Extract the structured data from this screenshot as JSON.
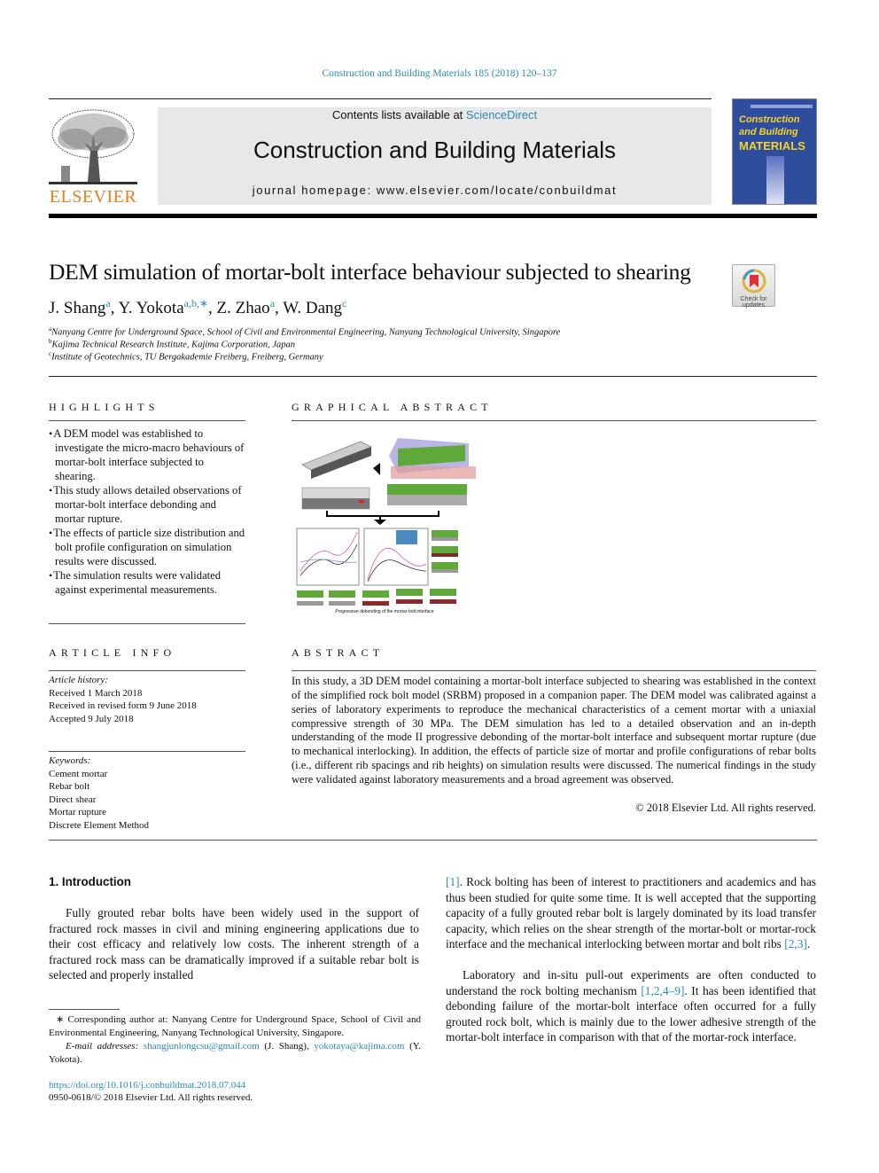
{
  "header": {
    "journal_ref": "Construction and Building Materials 185 (2018) 120–137",
    "contents_prefix": "Contents lists available at ",
    "contents_link": "ScienceDirect",
    "journal_title": "Construction and Building Materials",
    "homepage_prefix": "journal homepage: ",
    "homepage_url": "www.elsevier.com/locate/conbuildmat",
    "publisher_logo": "ELSEVIER",
    "cover": {
      "line1": "Construction",
      "line2": "and Building",
      "line3": "MATERIALS"
    },
    "check_updates": "Check for updates"
  },
  "article": {
    "title": "DEM simulation of mortar-bolt interface behaviour subjected to shearing",
    "authors": [
      {
        "name": "J. Shang",
        "sup": "a"
      },
      {
        "name": "Y. Yokota",
        "sup": "a,b,∗"
      },
      {
        "name": "Z. Zhao",
        "sup": "a"
      },
      {
        "name": "W. Dang",
        "sup": "c"
      }
    ],
    "affiliations": [
      {
        "sup": "a",
        "text": "Nanyang Centre for Underground Space, School of Civil and Environmental Engineering, Nanyang Technological University, Singapore"
      },
      {
        "sup": "b",
        "text": "Kajima Technical Research Institute, Kajima Corporation, Japan"
      },
      {
        "sup": "c",
        "text": "Institute of Geotechnics, TU Bergakademie Freiberg, Freiberg, Germany"
      }
    ]
  },
  "highlights": {
    "heading": "HIGHLIGHTS",
    "items": [
      "A DEM model was established to investigate the micro-macro behaviours of mortar-bolt interface subjected to shearing.",
      "This study allows detailed observations of mortar-bolt interface debonding and mortar rupture.",
      "The effects of particle size distribution and bolt profile configuration on simulation results were discussed.",
      "The simulation results were validated against experimental measurements."
    ]
  },
  "graphical_abstract": {
    "heading": "GRAPHICAL ABSTRACT",
    "caption": "Progressive debonding of the mortar-bolt interface"
  },
  "article_info": {
    "heading": "ARTICLE INFO",
    "history_label": "Article history:",
    "history": [
      "Received 1 March 2018",
      "Received in revised form 9 June 2018",
      "Accepted 9 July 2018"
    ],
    "keywords_label": "Keywords:",
    "keywords": [
      "Cement mortar",
      "Rebar bolt",
      "Direct shear",
      "Mortar rupture",
      "Discrete Element Method"
    ]
  },
  "abstract": {
    "heading": "ABSTRACT",
    "text": "In this study, a 3D DEM model containing a mortar-bolt interface subjected to shearing was established in the context of the simplified rock bolt model (SRBM) proposed in a companion paper. The DEM model was calibrated against a series of laboratory experiments to reproduce the mechanical characteristics of a cement mortar with a uniaxial compressive strength of 30 MPa. The DEM simulation has led to a detailed observation and an in-depth understanding of the mode II progressive debonding of the mortar-bolt interface and subsequent mortar rupture (due to mechanical interlocking). In addition, the effects of particle size of mortar and profile configurations of rebar bolts (i.e., different rib spacings and rib heights) on simulation results were discussed. The numerical findings in the study were validated against laboratory measurements and a broad agreement was observed.",
    "copyright": "© 2018 Elsevier Ltd. All rights reserved."
  },
  "intro": {
    "heading": "1. Introduction",
    "p1": "Fully grouted rebar bolts have been widely used in the support of fractured rock masses in civil and mining engineering applications due to their cost efficacy and relatively low costs. The inherent strength of a fractured rock mass can be dramatically improved if a suitable rebar bolt is selected and properly installed",
    "p2_ref": "[1]",
    "p2": ". Rock bolting has been of interest to practitioners and academics and has thus been studied for quite some time. It is well accepted that the supporting capacity of a fully grouted rebar bolt is largely dominated by its load transfer capacity, which relies on the shear strength of the mortar-bolt or mortar-rock interface and the mechanical interlocking between mortar and bolt ribs ",
    "p2_ref2": "[2,3]",
    "p3a": "Laboratory and in-situ pull-out experiments are often conducted to understand the rock bolting mechanism ",
    "p3_ref": "[1,2,4–9]",
    "p3b": ". It has been identified that debonding failure of the mortar-bolt interface often occurred for a fully grouted rock bolt, which is mainly due to the lower adhesive strength of the mortar-bolt interface in comparison with that of the mortar-rock interface."
  },
  "footnotes": {
    "corresponding": "∗ Corresponding author at: Nanyang Centre for Underground Space, School of Civil and Environmental Engineering, Nanyang Technological University, Singapore.",
    "email_label": "E-mail addresses:",
    "email1": "shangjunlongcsu@gmail.com",
    "email1_who": " (J. Shang), ",
    "email2": "yokotaya@kajima.com",
    "email2_who": " (Y. Yokota).",
    "doi": "https://doi.org/10.1016/j.conbuildmat.2018.07.044",
    "issn": "0950-0618/© 2018 Elsevier Ltd. All rights reserved."
  },
  "colors": {
    "link": "#2a8ab8",
    "elsevier_orange": "#f07a1c",
    "cover_blue": "#2f4d9d",
    "banner_gray": "#e8e8e8"
  }
}
